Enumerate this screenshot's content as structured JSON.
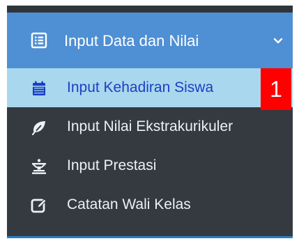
{
  "menu": {
    "header": {
      "label": "Input Data dan Nilai",
      "icon": "list-alt-icon",
      "chevron": "chevron-down-icon",
      "color": "#4f8fd3"
    },
    "items": [
      {
        "label": "Input Kehadiran Siswa",
        "icon": "calendar-icon",
        "active": true
      },
      {
        "label": "Input Nilai Ekstrakurikuler",
        "icon": "leaf-icon",
        "active": false
      },
      {
        "label": "Input Prestasi",
        "icon": "trophy-icon",
        "active": false
      },
      {
        "label": "Catatan Wali Kelas",
        "icon": "edit-icon",
        "active": false
      }
    ],
    "active_color": "#a9d7ee",
    "background": "#343a40"
  },
  "annotation": {
    "badge_number": "1",
    "color": "#ff0000"
  }
}
